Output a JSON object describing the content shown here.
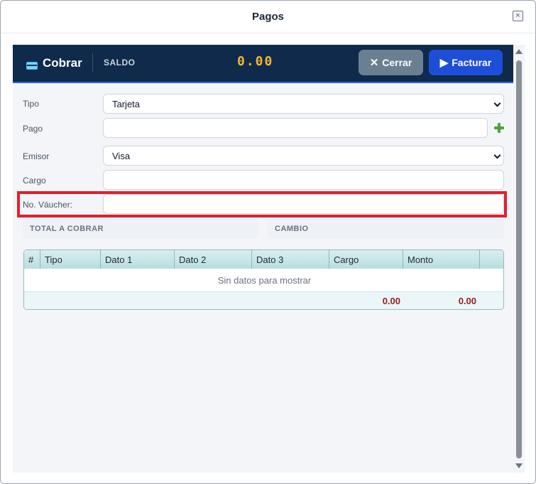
{
  "dialog": {
    "title": "Pagos",
    "close_glyph": "×"
  },
  "topbar": {
    "title": "Cobrar",
    "icon": "credit-card-icon",
    "saldo_label": "SALDO",
    "saldo_value": "0.00",
    "cerrar_label": "Cerrar",
    "facturar_label": "Facturar",
    "colors": {
      "bar": "#0f2a4a",
      "saldo": "#f5b731",
      "cerrar": "#6b7f93",
      "facturar": "#1d4ed8"
    }
  },
  "form": {
    "tipo": {
      "label": "Tipo",
      "value": "Tarjeta"
    },
    "pago": {
      "label": "Pago",
      "value": ""
    },
    "emisor": {
      "label": "Emisor",
      "value": "Visa"
    },
    "cargo": {
      "label": "Cargo",
      "value": ""
    },
    "voucher": {
      "label": "No. Váucher:",
      "value": ""
    }
  },
  "summary": {
    "total_label": "TOTAL A COBRAR",
    "cambio_label": "CAMBIO"
  },
  "grid": {
    "columns": [
      "#",
      "Tipo",
      "Dato 1",
      "Dato 2",
      "Dato 3",
      "Cargo",
      "Monto"
    ],
    "empty_text": "Sin datos para mostrar",
    "footer": {
      "cargo_total": "0.00",
      "monto_total": "0.00"
    }
  }
}
